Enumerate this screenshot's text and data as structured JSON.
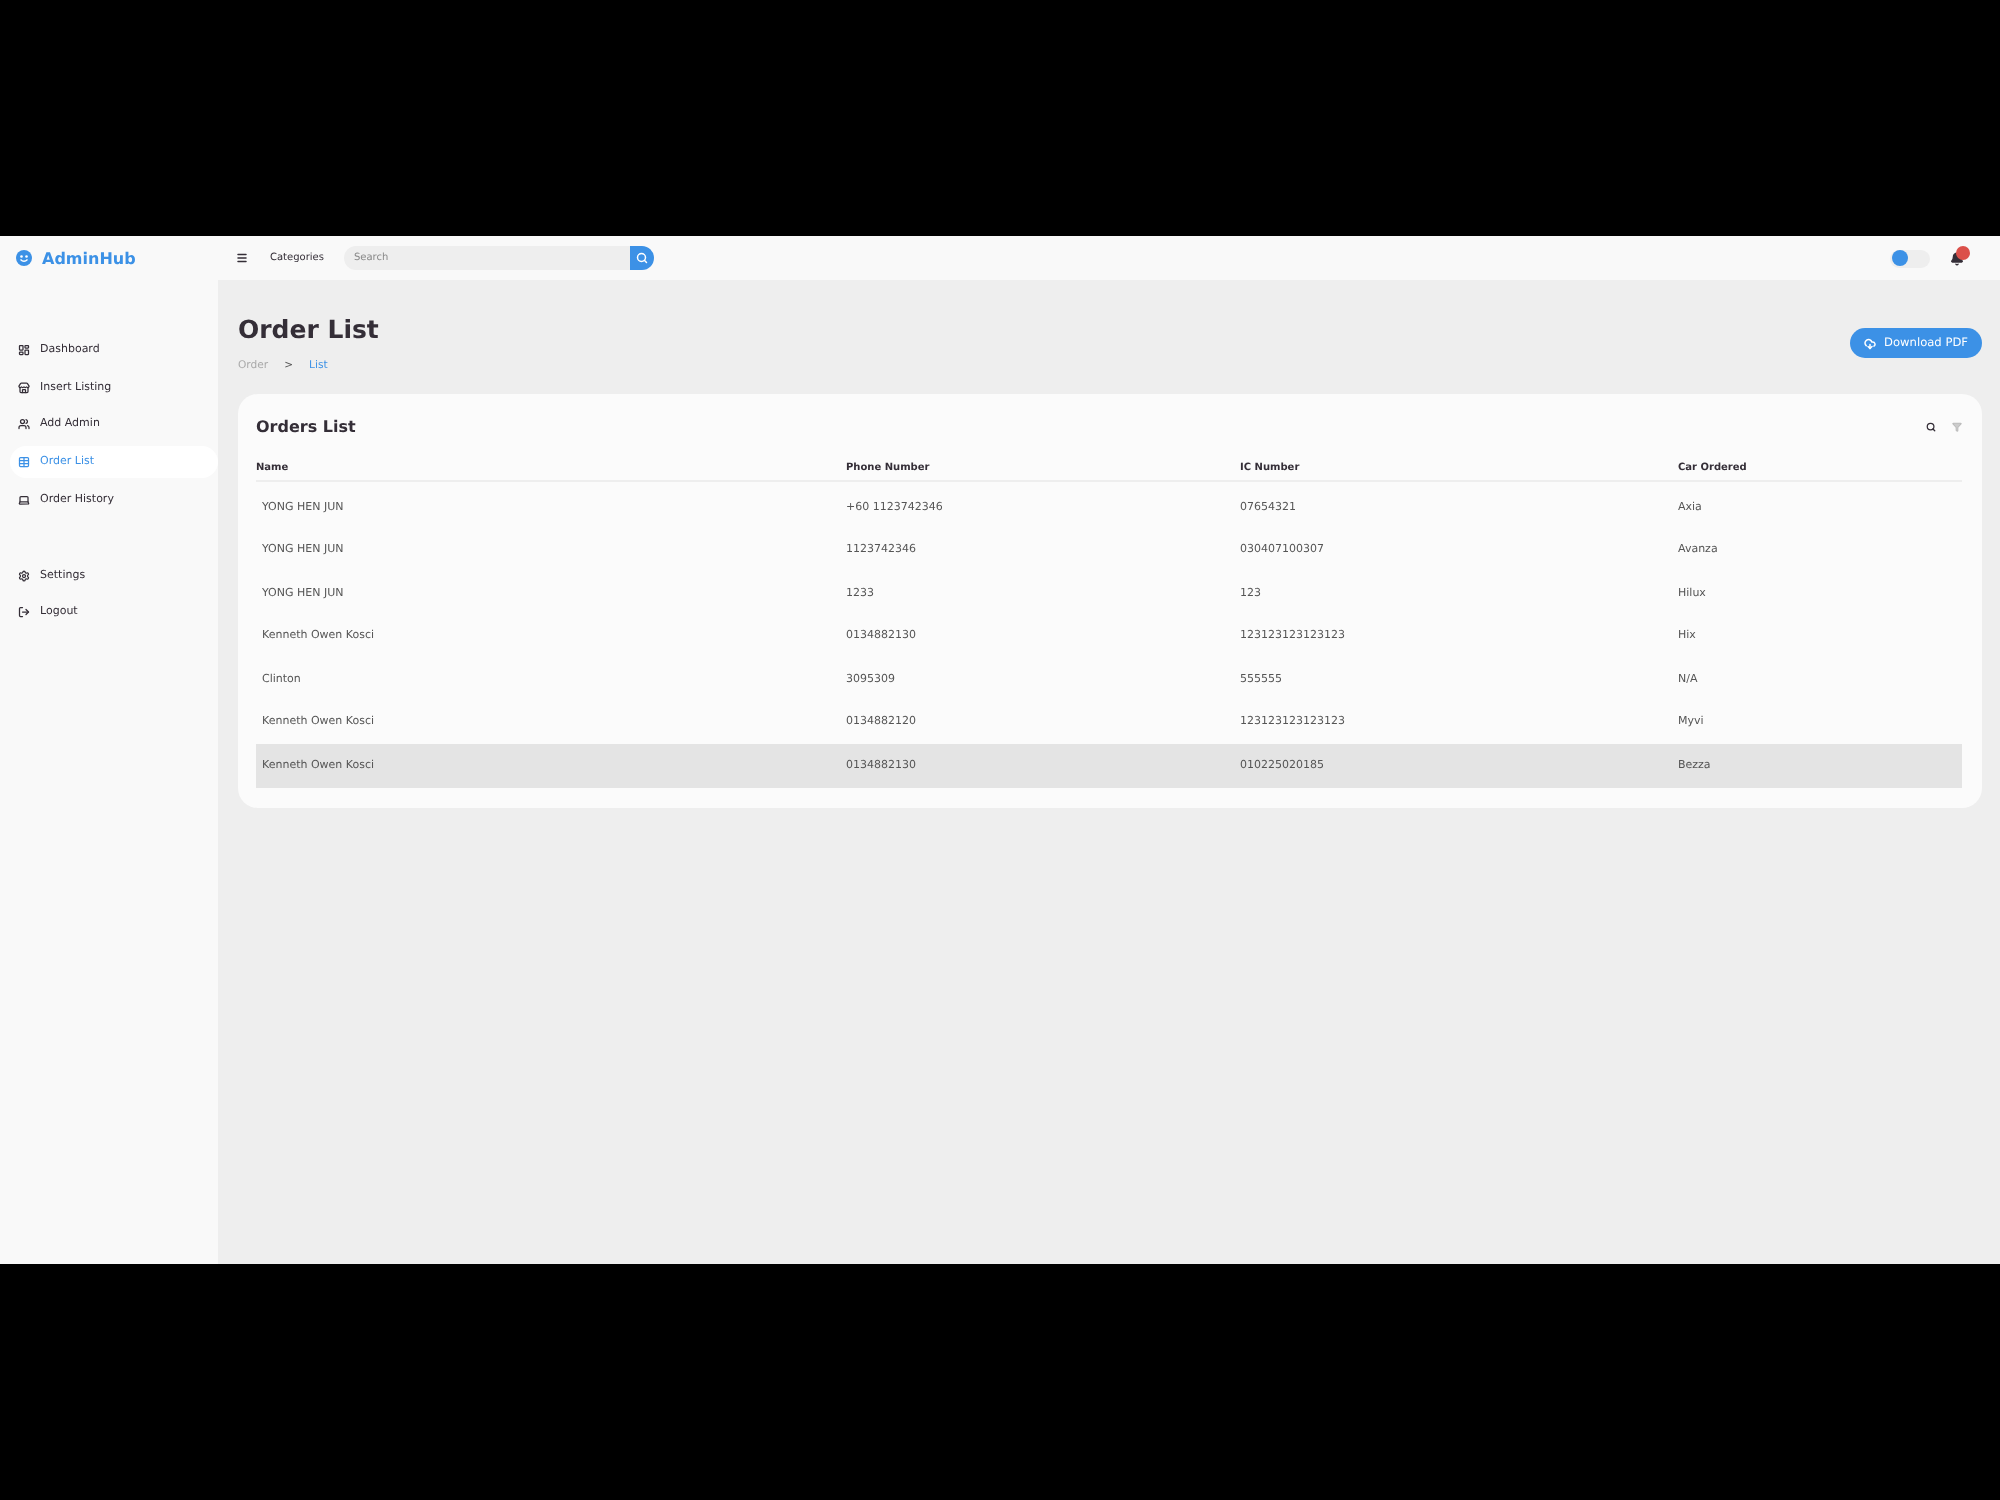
{
  "brand": {
    "name": "AdminHub"
  },
  "sidebar": {
    "items": [
      {
        "label": "Dashboard",
        "selected": false
      },
      {
        "label": "Insert Listing",
        "selected": false
      },
      {
        "label": "Add Admin",
        "selected": false
      },
      {
        "label": "Order List",
        "selected": true
      },
      {
        "label": "Order History",
        "selected": false
      }
    ],
    "bottom_items": [
      {
        "label": "Settings",
        "selected": false
      },
      {
        "label": "Logout",
        "selected": false
      }
    ]
  },
  "topbar": {
    "categories_label": "Categories",
    "search": {
      "placeholder": "Search"
    },
    "theme_switch": {
      "on": false
    }
  },
  "header": {
    "title": "Order List",
    "breadcrumb": [
      {
        "label": "Order",
        "selected": false
      },
      {
        "label": "List",
        "selected": true
      }
    ],
    "breadcrumb_separator": ">",
    "download_button": {
      "label": "Download PDF"
    }
  },
  "orders": {
    "title": "Orders List",
    "columns": [
      "Name",
      "Phone Number",
      "IC Number",
      "Car Ordered"
    ],
    "rows": [
      {
        "cells": [
          "YONG HEN JUN",
          "+60 1123742346",
          "07654321",
          "Axia"
        ],
        "selected": false
      },
      {
        "cells": [
          "YONG HEN JUN",
          "1123742346",
          "030407100307",
          "Avanza"
        ],
        "selected": false
      },
      {
        "cells": [
          "YONG HEN JUN",
          "1233",
          "123",
          "Hilux"
        ],
        "selected": false
      },
      {
        "cells": [
          "Kenneth Owen Kosci",
          "0134882130",
          "123123123123123",
          "Hix"
        ],
        "selected": false
      },
      {
        "cells": [
          "Clinton",
          "3095309",
          "555555",
          "N/A"
        ],
        "selected": false
      },
      {
        "cells": [
          "Kenneth Owen Kosci",
          "0134882120",
          "123123123123123",
          "Myvi"
        ],
        "selected": false
      },
      {
        "cells": [
          "Kenneth Owen Kosci",
          "0134882130",
          "010225020185",
          "Bezza"
        ],
        "selected": true
      }
    ]
  }
}
